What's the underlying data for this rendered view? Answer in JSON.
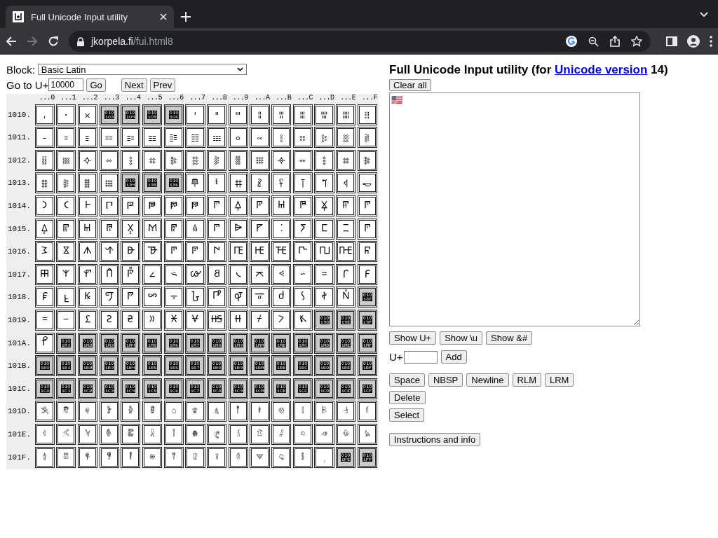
{
  "browser": {
    "tab": {
      "title": "Full Unicode Input utility",
      "selected": true
    },
    "url": {
      "host": "jkorpela.fi",
      "path": "/fui.html8"
    }
  },
  "controls": {
    "block_label": "Block:",
    "block_value": "Basic Latin",
    "goto_label": "Go to U+",
    "goto_value": "10000",
    "buttons": [
      "Go",
      "Next",
      "Prev"
    ]
  },
  "grid": {
    "columns": [
      "...0",
      "...1",
      "...2",
      "...3",
      "...4",
      "...5",
      "...6",
      "...7",
      "...8",
      "...9",
      "...A",
      "...B",
      "...C",
      "...D",
      "...E",
      "...F"
    ],
    "rows": [
      {
        "label": "1010.",
        "cells": [
          {
            "char": "𐄀",
            "assigned": true
          },
          {
            "char": "𐄁",
            "assigned": true
          },
          {
            "char": "𐄂",
            "assigned": true
          },
          {
            "char": "𐄃",
            "assigned": false
          },
          {
            "char": "𐄄",
            "assigned": false
          },
          {
            "char": "𐄅",
            "assigned": false
          },
          {
            "char": "𐄆",
            "assigned": false
          },
          {
            "char": "𐄇",
            "assigned": true
          },
          {
            "char": "𐄈",
            "assigned": true
          },
          {
            "char": "𐄉",
            "assigned": true
          },
          {
            "char": "𐄊",
            "assigned": true
          },
          {
            "char": "𐄋",
            "assigned": true
          },
          {
            "char": "𐄌",
            "assigned": true
          },
          {
            "char": "𐄍",
            "assigned": true
          },
          {
            "char": "𐄎",
            "assigned": true
          },
          {
            "char": "𐄏",
            "assigned": true
          }
        ]
      },
      {
        "label": "1011.",
        "cells": [
          {
            "char": "𐄐",
            "assigned": true
          },
          {
            "char": "𐄑",
            "assigned": true
          },
          {
            "char": "𐄒",
            "assigned": true
          },
          {
            "char": "𐄓",
            "assigned": true
          },
          {
            "char": "𐄔",
            "assigned": true
          },
          {
            "char": "𐄕",
            "assigned": true
          },
          {
            "char": "𐄖",
            "assigned": true
          },
          {
            "char": "𐄗",
            "assigned": true
          },
          {
            "char": "𐄘",
            "assigned": true
          },
          {
            "char": "𐄙",
            "assigned": true
          },
          {
            "char": "𐄚",
            "assigned": true
          },
          {
            "char": "𐄛",
            "assigned": true
          },
          {
            "char": "𐄜",
            "assigned": true
          },
          {
            "char": "𐄝",
            "assigned": true
          },
          {
            "char": "𐄞",
            "assigned": true
          },
          {
            "char": "𐄟",
            "assigned": true
          }
        ]
      },
      {
        "label": "1012.",
        "cells": [
          {
            "char": "𐄠",
            "assigned": true
          },
          {
            "char": "𐄡",
            "assigned": true
          },
          {
            "char": "𐄢",
            "assigned": true
          },
          {
            "char": "𐄣",
            "assigned": true
          },
          {
            "char": "𐄤",
            "assigned": true
          },
          {
            "char": "𐄥",
            "assigned": true
          },
          {
            "char": "𐄦",
            "assigned": true
          },
          {
            "char": "𐄧",
            "assigned": true
          },
          {
            "char": "𐄨",
            "assigned": true
          },
          {
            "char": "𐄩",
            "assigned": true
          },
          {
            "char": "𐄪",
            "assigned": true
          },
          {
            "char": "𐄫",
            "assigned": true
          },
          {
            "char": "𐄬",
            "assigned": true
          },
          {
            "char": "𐄭",
            "assigned": true
          },
          {
            "char": "𐄮",
            "assigned": true
          },
          {
            "char": "𐄯",
            "assigned": true
          }
        ]
      },
      {
        "label": "1013.",
        "cells": [
          {
            "char": "𐄰",
            "assigned": true
          },
          {
            "char": "𐄱",
            "assigned": true
          },
          {
            "char": "𐄲",
            "assigned": true
          },
          {
            "char": "𐄳",
            "assigned": true
          },
          {
            "char": "𐄴",
            "assigned": false
          },
          {
            "char": "𐄵",
            "assigned": false
          },
          {
            "char": "𐄶",
            "assigned": false
          },
          {
            "char": "𐄷",
            "assigned": true
          },
          {
            "char": "𐄸",
            "assigned": true
          },
          {
            "char": "𐄹",
            "assigned": true
          },
          {
            "char": "𐄺",
            "assigned": true
          },
          {
            "char": "𐄻",
            "assigned": true
          },
          {
            "char": "𐄼",
            "assigned": true
          },
          {
            "char": "𐄽",
            "assigned": true
          },
          {
            "char": "𐄾",
            "assigned": true
          },
          {
            "char": "𐄿",
            "assigned": true
          }
        ]
      },
      {
        "label": "1014.",
        "cells": [
          {
            "char": "𐅀",
            "assigned": true
          },
          {
            "char": "𐅁",
            "assigned": true
          },
          {
            "char": "𐅂",
            "assigned": true
          },
          {
            "char": "𐅃",
            "assigned": true
          },
          {
            "char": "𐅄",
            "assigned": true
          },
          {
            "char": "𐅅",
            "assigned": true
          },
          {
            "char": "𐅆",
            "assigned": true
          },
          {
            "char": "𐅇",
            "assigned": true
          },
          {
            "char": "𐅈",
            "assigned": true
          },
          {
            "char": "𐅉",
            "assigned": true
          },
          {
            "char": "𐅊",
            "assigned": true
          },
          {
            "char": "𐅋",
            "assigned": true
          },
          {
            "char": "𐅌",
            "assigned": true
          },
          {
            "char": "𐅍",
            "assigned": true
          },
          {
            "char": "𐅎",
            "assigned": true
          },
          {
            "char": "𐅏",
            "assigned": true
          }
        ]
      },
      {
        "label": "1015.",
        "cells": [
          {
            "char": "𐅐",
            "assigned": true
          },
          {
            "char": "𐅑",
            "assigned": true
          },
          {
            "char": "𐅒",
            "assigned": true
          },
          {
            "char": "𐅓",
            "assigned": true
          },
          {
            "char": "𐅔",
            "assigned": true
          },
          {
            "char": "𐅕",
            "assigned": true
          },
          {
            "char": "𐅖",
            "assigned": true
          },
          {
            "char": "𐅗",
            "assigned": true
          },
          {
            "char": "𐅘",
            "assigned": true
          },
          {
            "char": "𐅙",
            "assigned": true
          },
          {
            "char": "𐅚",
            "assigned": true
          },
          {
            "char": "𐅛",
            "assigned": true
          },
          {
            "char": "𐅜",
            "assigned": true
          },
          {
            "char": "𐅝",
            "assigned": true
          },
          {
            "char": "𐅞",
            "assigned": true
          },
          {
            "char": "𐅟",
            "assigned": true
          }
        ]
      },
      {
        "label": "1016.",
        "cells": [
          {
            "char": "𐅠",
            "assigned": true
          },
          {
            "char": "𐅡",
            "assigned": true
          },
          {
            "char": "𐅢",
            "assigned": true
          },
          {
            "char": "𐅣",
            "assigned": true
          },
          {
            "char": "𐅤",
            "assigned": true
          },
          {
            "char": "𐅥",
            "assigned": true
          },
          {
            "char": "𐅦",
            "assigned": true
          },
          {
            "char": "𐅧",
            "assigned": true
          },
          {
            "char": "𐅨",
            "assigned": true
          },
          {
            "char": "𐅩",
            "assigned": true
          },
          {
            "char": "𐅪",
            "assigned": true
          },
          {
            "char": "𐅫",
            "assigned": true
          },
          {
            "char": "𐅬",
            "assigned": true
          },
          {
            "char": "𐅭",
            "assigned": true
          },
          {
            "char": "𐅮",
            "assigned": true
          },
          {
            "char": "𐅯",
            "assigned": true
          }
        ]
      },
      {
        "label": "1017.",
        "cells": [
          {
            "char": "𐅰",
            "assigned": true
          },
          {
            "char": "𐅱",
            "assigned": true
          },
          {
            "char": "𐅲",
            "assigned": true
          },
          {
            "char": "𐅳",
            "assigned": true
          },
          {
            "char": "𐅴",
            "assigned": true
          },
          {
            "char": "𐅵",
            "assigned": true
          },
          {
            "char": "𐅶",
            "assigned": true
          },
          {
            "char": "𐅷",
            "assigned": true
          },
          {
            "char": "𐅸",
            "assigned": true
          },
          {
            "char": "𐅹",
            "assigned": true
          },
          {
            "char": "𐅺",
            "assigned": true
          },
          {
            "char": "𐅻",
            "assigned": true
          },
          {
            "char": "𐅼",
            "assigned": true
          },
          {
            "char": "𐅽",
            "assigned": true
          },
          {
            "char": "𐅾",
            "assigned": true
          },
          {
            "char": "𐅿",
            "assigned": true
          }
        ]
      },
      {
        "label": "1018.",
        "cells": [
          {
            "char": "𐆀",
            "assigned": true
          },
          {
            "char": "𐆁",
            "assigned": true
          },
          {
            "char": "𐆂",
            "assigned": true
          },
          {
            "char": "𐆃",
            "assigned": true
          },
          {
            "char": "𐆄",
            "assigned": true
          },
          {
            "char": "𐆅",
            "assigned": true
          },
          {
            "char": "𐆆",
            "assigned": true
          },
          {
            "char": "𐆇",
            "assigned": true
          },
          {
            "char": "𐆈",
            "assigned": true
          },
          {
            "char": "𐆉",
            "assigned": true
          },
          {
            "char": "𐆊",
            "assigned": true
          },
          {
            "char": "𐆋",
            "assigned": true
          },
          {
            "char": "𐆌",
            "assigned": true
          },
          {
            "char": "𐆍",
            "assigned": true
          },
          {
            "char": "𐆎",
            "assigned": true
          },
          {
            "char": "𐆏",
            "assigned": false
          }
        ]
      },
      {
        "label": "1019.",
        "cells": [
          {
            "char": "𐆐",
            "assigned": true
          },
          {
            "char": "𐆑",
            "assigned": true
          },
          {
            "char": "𐆒",
            "assigned": true
          },
          {
            "char": "𐆓",
            "assigned": true
          },
          {
            "char": "𐆔",
            "assigned": true
          },
          {
            "char": "𐆕",
            "assigned": true
          },
          {
            "char": "𐆖",
            "assigned": true
          },
          {
            "char": "𐆗",
            "assigned": true
          },
          {
            "char": "𐆘",
            "assigned": true
          },
          {
            "char": "𐆙",
            "assigned": true
          },
          {
            "char": "𐆚",
            "assigned": true
          },
          {
            "char": "𐆛",
            "assigned": true
          },
          {
            "char": "𐆜",
            "assigned": true
          },
          {
            "char": "𐆝",
            "assigned": false
          },
          {
            "char": "𐆞",
            "assigned": false
          },
          {
            "char": "𐆟",
            "assigned": false
          }
        ]
      },
      {
        "label": "101A.",
        "cells": [
          {
            "char": "𐆠",
            "assigned": true
          },
          {
            "char": "𐆡",
            "assigned": false
          },
          {
            "char": "𐆢",
            "assigned": false
          },
          {
            "char": "𐆣",
            "assigned": false
          },
          {
            "char": "𐆤",
            "assigned": false
          },
          {
            "char": "𐆥",
            "assigned": false
          },
          {
            "char": "𐆦",
            "assigned": false
          },
          {
            "char": "𐆧",
            "assigned": false
          },
          {
            "char": "𐆨",
            "assigned": false
          },
          {
            "char": "𐆩",
            "assigned": false
          },
          {
            "char": "𐆪",
            "assigned": false
          },
          {
            "char": "𐆫",
            "assigned": false
          },
          {
            "char": "𐆬",
            "assigned": false
          },
          {
            "char": "𐆭",
            "assigned": false
          },
          {
            "char": "𐆮",
            "assigned": false
          },
          {
            "char": "𐆯",
            "assigned": false
          }
        ]
      },
      {
        "label": "101B.",
        "cells": [
          {
            "char": "𐆰",
            "assigned": false
          },
          {
            "char": "𐆱",
            "assigned": false
          },
          {
            "char": "𐆲",
            "assigned": false
          },
          {
            "char": "𐆳",
            "assigned": false
          },
          {
            "char": "𐆴",
            "assigned": false
          },
          {
            "char": "𐆵",
            "assigned": false
          },
          {
            "char": "𐆶",
            "assigned": false
          },
          {
            "char": "𐆷",
            "assigned": false
          },
          {
            "char": "𐆸",
            "assigned": false
          },
          {
            "char": "𐆹",
            "assigned": false
          },
          {
            "char": "𐆺",
            "assigned": false
          },
          {
            "char": "𐆻",
            "assigned": false
          },
          {
            "char": "𐆼",
            "assigned": false
          },
          {
            "char": "𐆽",
            "assigned": false
          },
          {
            "char": "𐆾",
            "assigned": false
          },
          {
            "char": "𐆿",
            "assigned": false
          }
        ]
      },
      {
        "label": "101C.",
        "cells": [
          {
            "char": "𐇀",
            "assigned": false
          },
          {
            "char": "𐇁",
            "assigned": false
          },
          {
            "char": "𐇂",
            "assigned": false
          },
          {
            "char": "𐇃",
            "assigned": false
          },
          {
            "char": "𐇄",
            "assigned": false
          },
          {
            "char": "𐇅",
            "assigned": false
          },
          {
            "char": "𐇆",
            "assigned": false
          },
          {
            "char": "𐇇",
            "assigned": false
          },
          {
            "char": "𐇈",
            "assigned": false
          },
          {
            "char": "𐇉",
            "assigned": false
          },
          {
            "char": "𐇊",
            "assigned": false
          },
          {
            "char": "𐇋",
            "assigned": false
          },
          {
            "char": "𐇌",
            "assigned": false
          },
          {
            "char": "𐇍",
            "assigned": false
          },
          {
            "char": "𐇎",
            "assigned": false
          },
          {
            "char": "𐇏",
            "assigned": false
          }
        ]
      },
      {
        "label": "101D.",
        "cells": [
          {
            "char": "𐇐",
            "assigned": true
          },
          {
            "char": "𐇑",
            "assigned": true
          },
          {
            "char": "𐇒",
            "assigned": true
          },
          {
            "char": "𐇓",
            "assigned": true
          },
          {
            "char": "𐇔",
            "assigned": true
          },
          {
            "char": "𐇕",
            "assigned": true
          },
          {
            "char": "𐇖",
            "assigned": true
          },
          {
            "char": "𐇗",
            "assigned": true
          },
          {
            "char": "𐇘",
            "assigned": true
          },
          {
            "char": "𐇙",
            "assigned": true
          },
          {
            "char": "𐇚",
            "assigned": true
          },
          {
            "char": "𐇛",
            "assigned": true
          },
          {
            "char": "𐇜",
            "assigned": true
          },
          {
            "char": "𐇝",
            "assigned": true
          },
          {
            "char": "𐇞",
            "assigned": true
          },
          {
            "char": "𐇟",
            "assigned": true
          }
        ]
      },
      {
        "label": "101E.",
        "cells": [
          {
            "char": "𐇠",
            "assigned": true
          },
          {
            "char": "𐇡",
            "assigned": true
          },
          {
            "char": "𐇢",
            "assigned": true
          },
          {
            "char": "𐇣",
            "assigned": true
          },
          {
            "char": "𐇤",
            "assigned": true
          },
          {
            "char": "𐇥",
            "assigned": true
          },
          {
            "char": "𐇦",
            "assigned": true
          },
          {
            "char": "𐇧",
            "assigned": true
          },
          {
            "char": "𐇨",
            "assigned": true
          },
          {
            "char": "𐇩",
            "assigned": true
          },
          {
            "char": "𐇪",
            "assigned": true
          },
          {
            "char": "𐇫",
            "assigned": true
          },
          {
            "char": "𐇬",
            "assigned": true
          },
          {
            "char": "𐇭",
            "assigned": true
          },
          {
            "char": "𐇮",
            "assigned": true
          },
          {
            "char": "𐇯",
            "assigned": true
          }
        ]
      },
      {
        "label": "101F.",
        "cells": [
          {
            "char": "𐇰",
            "assigned": true
          },
          {
            "char": "𐇱",
            "assigned": true
          },
          {
            "char": "𐇲",
            "assigned": true
          },
          {
            "char": "𐇳",
            "assigned": true
          },
          {
            "char": "𐇴",
            "assigned": true
          },
          {
            "char": "𐇵",
            "assigned": true
          },
          {
            "char": "𐇶",
            "assigned": true
          },
          {
            "char": "𐇷",
            "assigned": true
          },
          {
            "char": "𐇸",
            "assigned": true
          },
          {
            "char": "𐇹",
            "assigned": true
          },
          {
            "char": "𐇺",
            "assigned": true
          },
          {
            "char": "𐇻",
            "assigned": true
          },
          {
            "char": "𐇼",
            "assigned": true
          },
          {
            "char": "𐇽",
            "assigned": true
          },
          {
            "char": "𐇾",
            "assigned": false
          },
          {
            "char": "𐇿",
            "assigned": false
          }
        ]
      }
    ]
  },
  "tool": {
    "title_before": "Full Unicode Input utility (for ",
    "title_link": "Unicode version",
    "title_after": " 14)",
    "clear_button": "Clear all",
    "text_value": "🇺🇸",
    "button_rows": [
      {
        "kind": "buttons",
        "buttons": [
          "Show U+",
          "Show \\u",
          "Show &#"
        ]
      },
      {
        "kind": "code-entry",
        "label": "U+",
        "buttons": [
          "Add"
        ]
      },
      {
        "kind": "buttons",
        "buttons": [
          "Space",
          "NBSP",
          "Newline",
          "RLM",
          "LRM"
        ]
      },
      {
        "kind": "buttons",
        "buttons": [
          "Delete"
        ]
      },
      {
        "kind": "buttons",
        "buttons": [
          "Select"
        ]
      },
      {
        "kind": "buttons",
        "buttons": [
          "Instructions and info"
        ]
      }
    ]
  }
}
